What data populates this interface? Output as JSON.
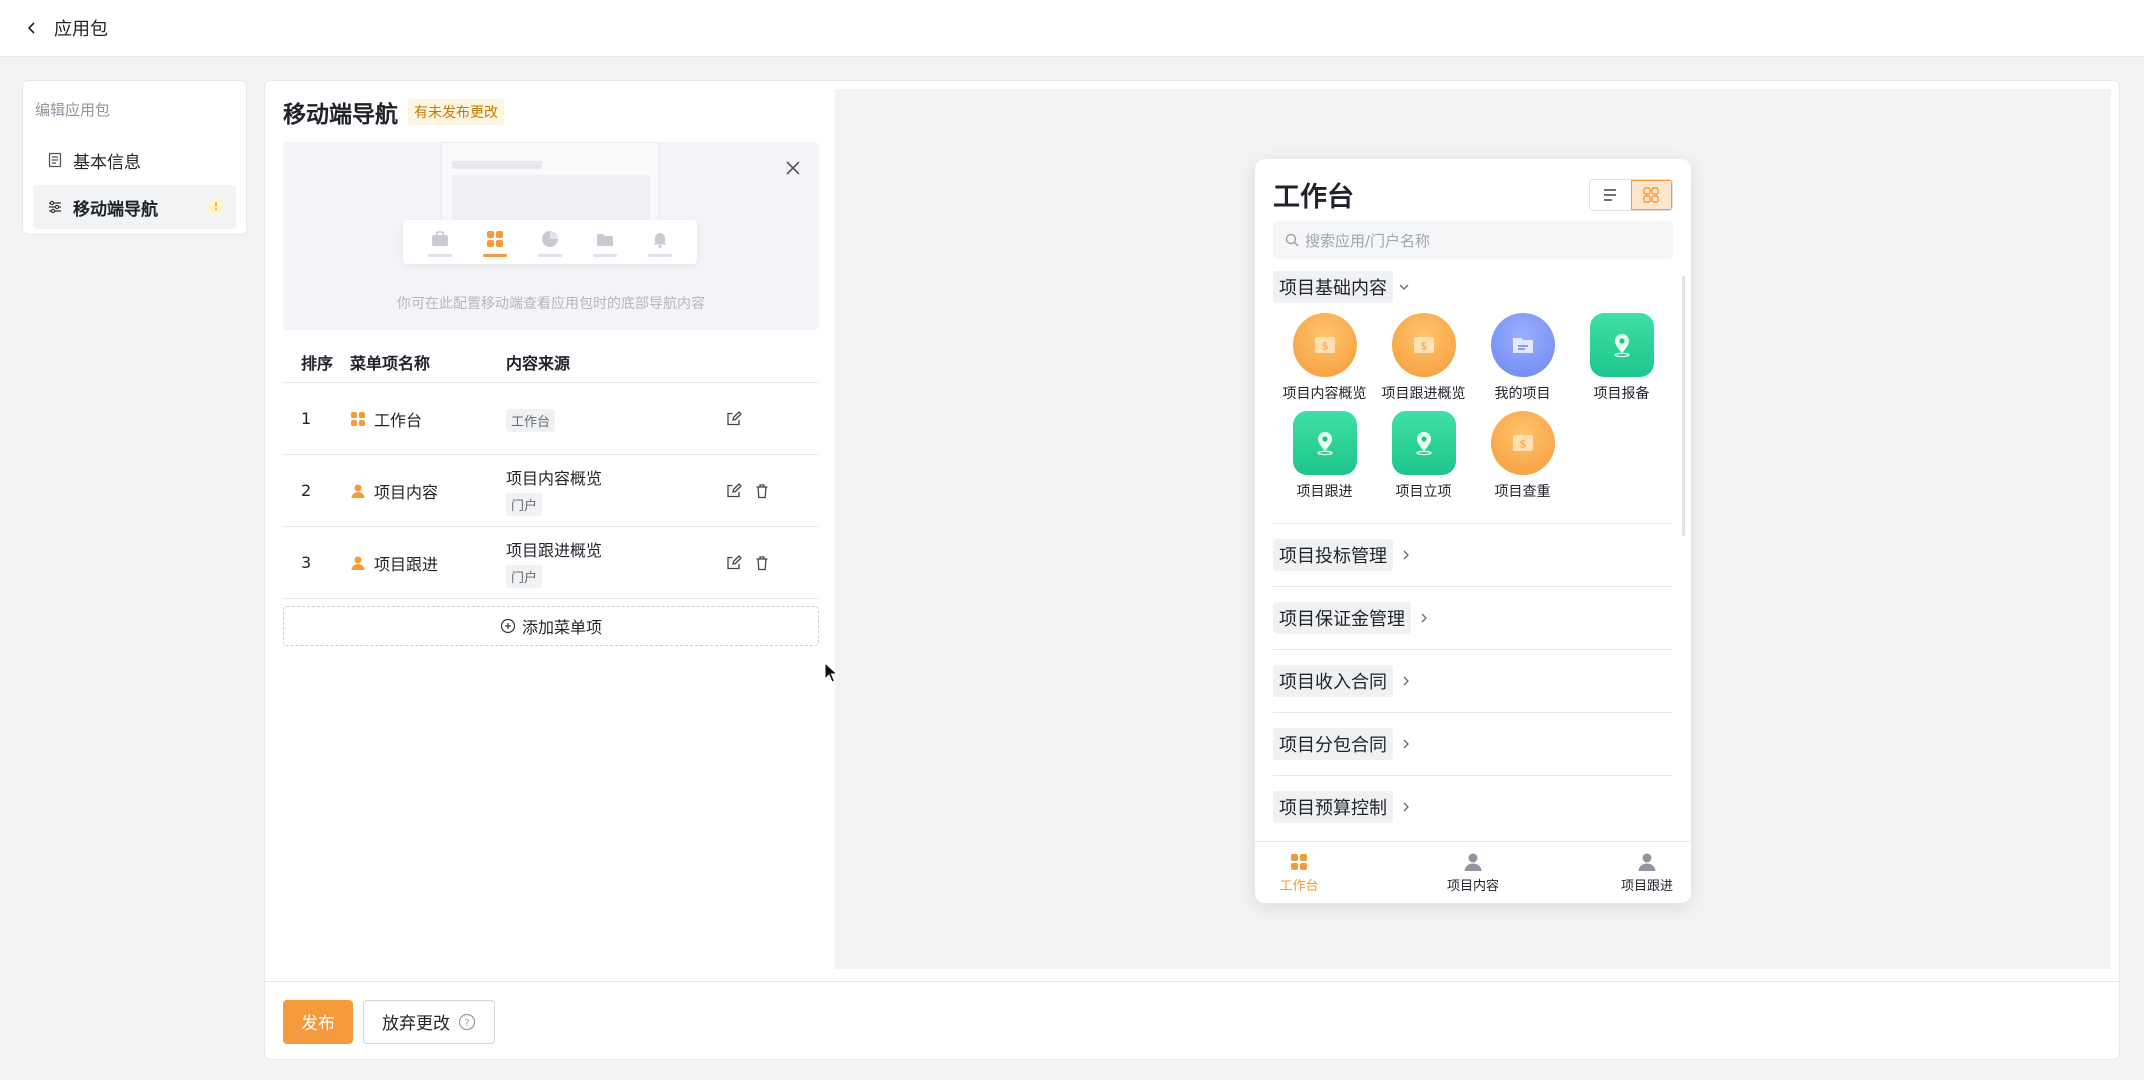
{
  "header": {
    "back_title": "应用包"
  },
  "sidebar": {
    "heading": "编辑应用包",
    "items": [
      {
        "label": "基本信息",
        "icon": "document-icon",
        "active": false
      },
      {
        "label": "移动端导航",
        "icon": "list-settings-icon",
        "active": true,
        "warning": "!"
      }
    ]
  },
  "panel": {
    "title": "移动端导航",
    "status_badge": "有未发布更改",
    "illustration_hint": "你可在此配置移动端查看应用包时的底部导航内容"
  },
  "table": {
    "headers": [
      "排序",
      "菜单项名称",
      "内容来源"
    ],
    "rows": [
      {
        "order": "1",
        "name": "工作台",
        "source": "",
        "tag": "工作台",
        "deletable": false
      },
      {
        "order": "2",
        "name": "项目内容",
        "source": "项目内容概览",
        "tag": "门户",
        "deletable": true
      },
      {
        "order": "3",
        "name": "项目跟进",
        "source": "项目跟进概览",
        "tag": "门户",
        "deletable": true
      }
    ],
    "add_label": "添加菜单项"
  },
  "phone": {
    "title": "工作台",
    "search_placeholder": "搜索应用/门户名称",
    "group_expanded": "项目基础内容",
    "apps": [
      {
        "label": "项目内容概览",
        "icon": "money-icon",
        "color": "#f59a3c"
      },
      {
        "label": "项目跟进概览",
        "icon": "money-icon",
        "color": "#f59a3c"
      },
      {
        "label": "我的项目",
        "icon": "folder-icon",
        "color": "#6a86f0"
      },
      {
        "label": "项目报备",
        "icon": "location-pin-icon",
        "color": "#1ec58b"
      },
      {
        "label": "项目跟进",
        "icon": "location-pin-icon",
        "color": "#1ec58b"
      },
      {
        "label": "项目立项",
        "icon": "location-pin-icon",
        "color": "#1ec58b"
      },
      {
        "label": "项目查重",
        "icon": "money-icon",
        "color": "#f59a3c"
      }
    ],
    "groups_collapsed": [
      "项目投标管理",
      "项目保证金管理",
      "项目收入合同",
      "项目分包合同",
      "项目预算控制"
    ],
    "tabs": [
      {
        "label": "工作台",
        "active": true
      },
      {
        "label": "项目内容",
        "active": false
      },
      {
        "label": "项目跟进",
        "active": false
      }
    ]
  },
  "footer": {
    "publish_label": "发布",
    "discard_label": "放弃更改"
  },
  "colors": {
    "accent": "#f59a3c",
    "green": "#1ec58b",
    "blue": "#6a86f0"
  }
}
